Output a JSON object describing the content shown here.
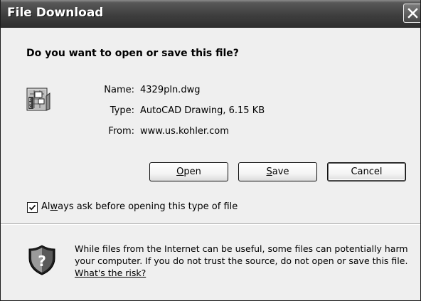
{
  "window": {
    "title": "File Download",
    "close_icon": "close-icon"
  },
  "prompt": {
    "question": "Do you want to open or save this file?"
  },
  "file": {
    "icon": "dwg-file-icon",
    "name_label": "Name:",
    "name_value": "4329pln.dwg",
    "type_label": "Type:",
    "type_value": "AutoCAD Drawing, 6.15 KB",
    "from_label": "From:",
    "from_value": "www.us.kohler.com"
  },
  "buttons": {
    "open": {
      "accel": "O",
      "rest": "pen"
    },
    "save": {
      "accel": "S",
      "rest": "ave"
    },
    "cancel": "Cancel"
  },
  "checkbox": {
    "checked": true,
    "label_pre": "Al",
    "label_accel": "w",
    "label_post": "ays ask before opening this type of file"
  },
  "warning": {
    "icon": "shield-question-icon",
    "text": "While files from the Internet can be useful, some files can potentially harm your computer. If you do not trust the source, do not open or save this file. ",
    "link": "What's the risk?"
  }
}
